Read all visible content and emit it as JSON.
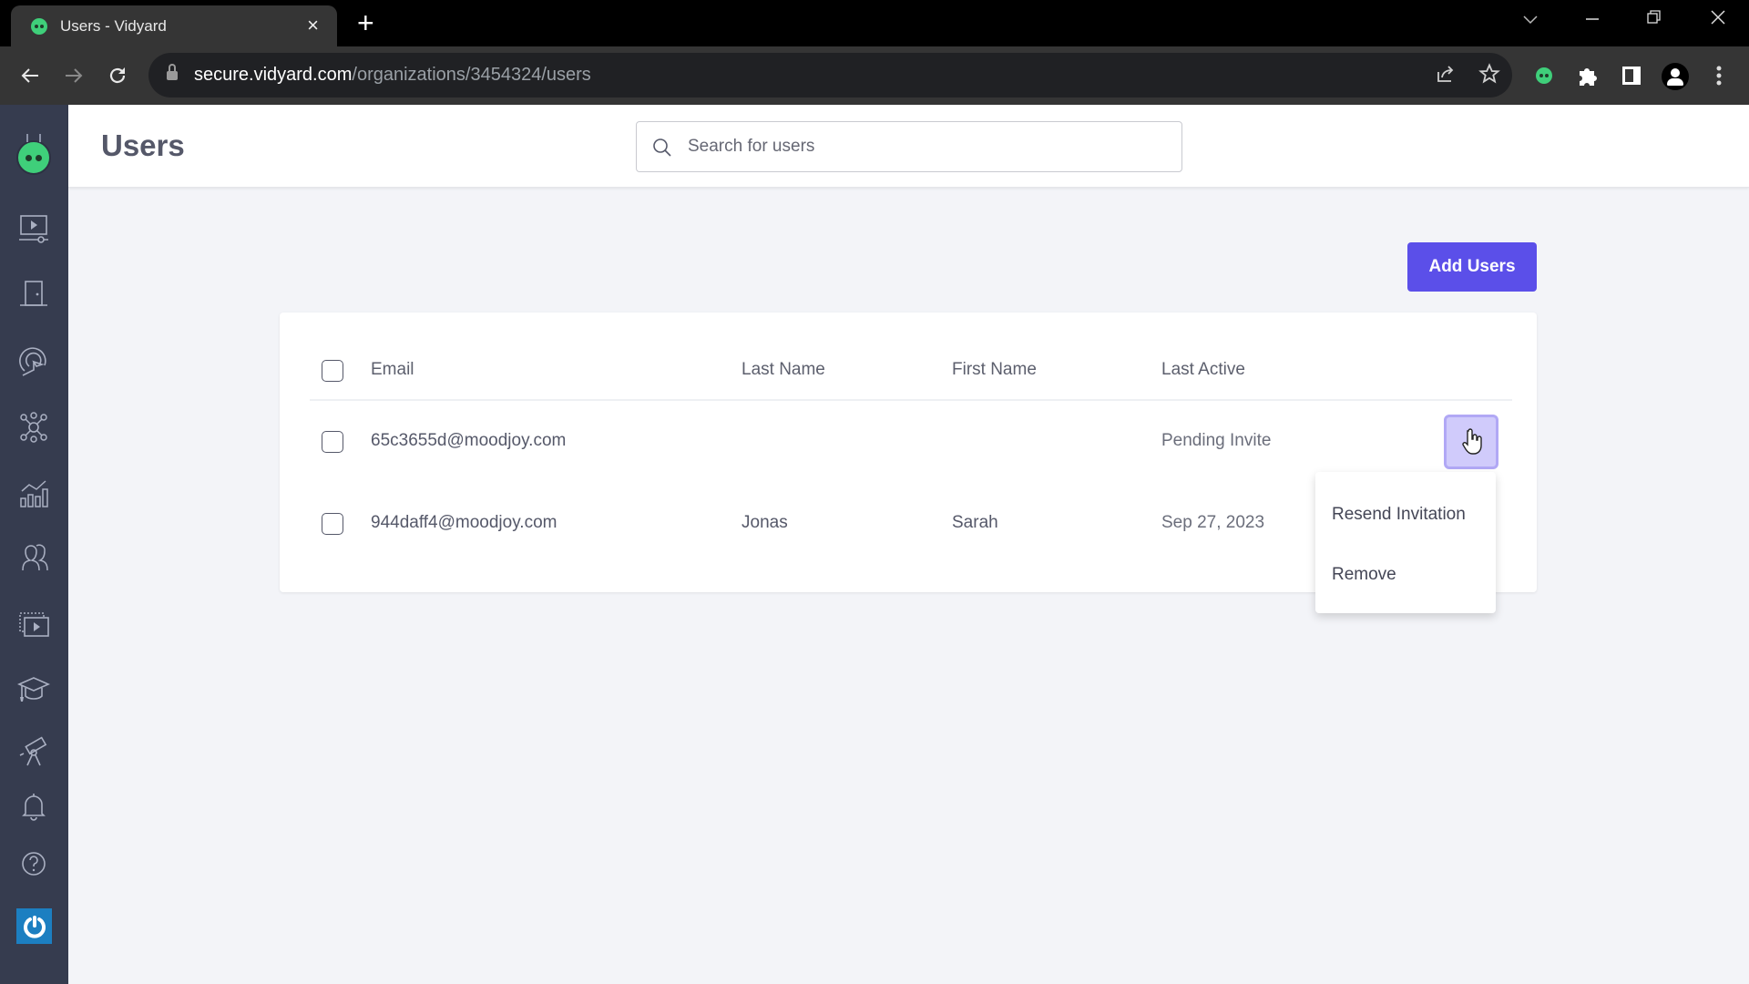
{
  "browser": {
    "tab_title": "Users - Vidyard",
    "tab_close": "×",
    "new_tab": "+",
    "url_host": "secure.vidyard.com",
    "url_path": "/organizations/3454324/users",
    "window_controls": {
      "tabsearch": "⌄",
      "minimize": "—",
      "restore": "❐",
      "close": "✕"
    },
    "nav": {
      "back": "←",
      "forward": "→",
      "reload": "↻"
    },
    "toolbar_icons": [
      "share-icon",
      "bookmark-star-icon",
      "vidyard-extension-icon",
      "extensions-puzzle-icon",
      "side-panel-icon",
      "profile-icon",
      "menu-kebab-icon"
    ]
  },
  "sidebar": {
    "items": [
      {
        "name": "vidyard-logo"
      },
      {
        "name": "videos"
      },
      {
        "name": "rooms"
      },
      {
        "name": "prospecting"
      },
      {
        "name": "integrations"
      },
      {
        "name": "analytics"
      },
      {
        "name": "team"
      },
      {
        "name": "channels"
      },
      {
        "name": "learning"
      },
      {
        "name": "discover"
      },
      {
        "name": "notifications"
      },
      {
        "name": "help"
      },
      {
        "name": "account-power"
      }
    ]
  },
  "header": {
    "title": "Users",
    "search_placeholder": "Search for users",
    "search_value": ""
  },
  "actions": {
    "add_users": "Add Users"
  },
  "table": {
    "columns": [
      "Email",
      "Last Name",
      "First Name",
      "Last Active"
    ],
    "rows": [
      {
        "email": "65c3655d@moodjoy.com",
        "last_name": "",
        "first_name": "",
        "last_active": "Pending Invite",
        "checked": false
      },
      {
        "email": "944daff4@moodjoy.com",
        "last_name": "Jonas",
        "first_name": "Sarah",
        "last_active": "Sep 27, 2023",
        "checked": false
      }
    ]
  },
  "row_menu": {
    "open_for_row": 0,
    "items": [
      "Resend Invitation",
      "Remove"
    ]
  },
  "colors": {
    "accent": "#5b4fe9",
    "sidebar_bg": "#363c4f",
    "page_bg": "#f3f4f8",
    "kebab_active_bg": "#d0cbfb",
    "brand_green": "#3fcf7a"
  }
}
